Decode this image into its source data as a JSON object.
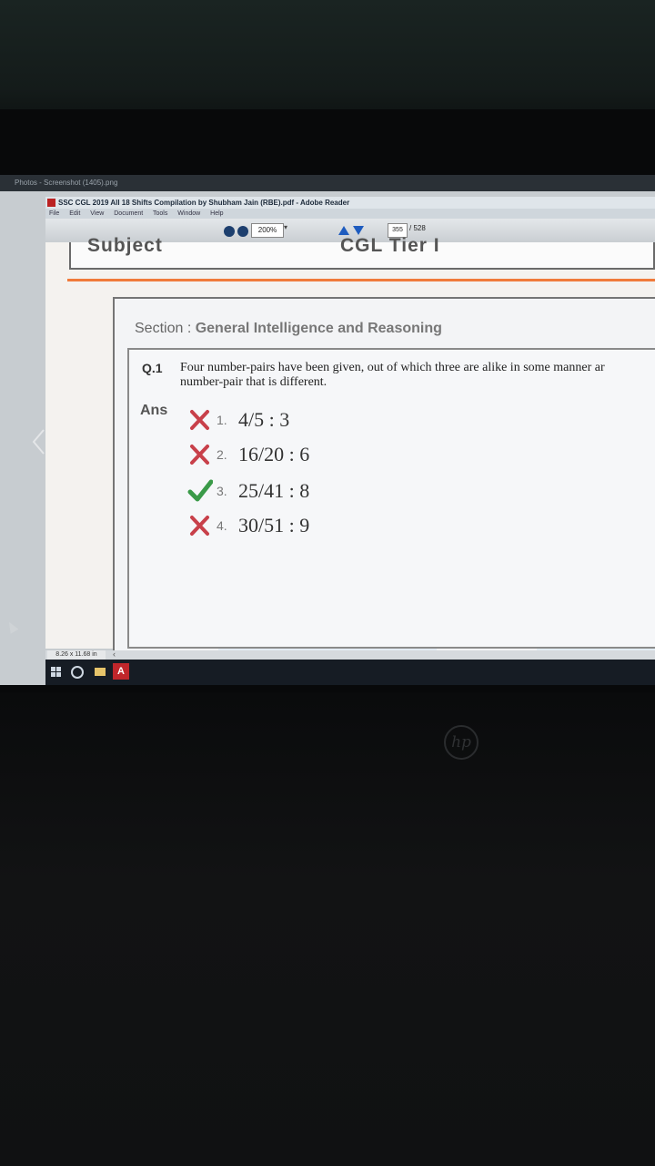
{
  "photos_bar": {
    "title": "Photos - Screenshot (1405).png"
  },
  "reader": {
    "window_title": "SSC CGL 2019 All 18 Shifts Compilation by Shubham Jain (RBE).pdf - Adobe Reader",
    "menu": [
      "File",
      "Edit",
      "View",
      "Document",
      "Tools",
      "Window",
      "Help"
    ],
    "zoom": "200%",
    "page_current": "355",
    "page_total": "/ 528",
    "page_size": "8.26 x 11.68 in"
  },
  "document": {
    "header_left": "Subject",
    "header_right": "CGL Tier I",
    "section_label": "Section : ",
    "section_name": "General Intelligence and Reasoning",
    "question": {
      "number": "Q.1",
      "line1": "Four number-pairs have been given, out of which three are alike in some manner ar",
      "line2": "number-pair that is different."
    },
    "ans_label": "Ans",
    "options": [
      {
        "num": "1.",
        "value": "4/5 : 3",
        "mark": "cross"
      },
      {
        "num": "2.",
        "value": "16/20 : 6",
        "mark": "cross"
      },
      {
        "num": "3.",
        "value": "25/41 : 8",
        "mark": "check"
      },
      {
        "num": "4.",
        "value": "30/51 : 9",
        "mark": "cross"
      }
    ]
  },
  "colors": {
    "cross": "#c8404a",
    "check": "#3a9a48",
    "orange_rule": "#f07a3a",
    "taskbar": "#161c24"
  },
  "icons": [
    "windows-start-icon",
    "cortana-icon",
    "file-explorer-icon",
    "adobe-reader-icon",
    "previous-arrow-icon",
    "next-arrow-icon"
  ]
}
